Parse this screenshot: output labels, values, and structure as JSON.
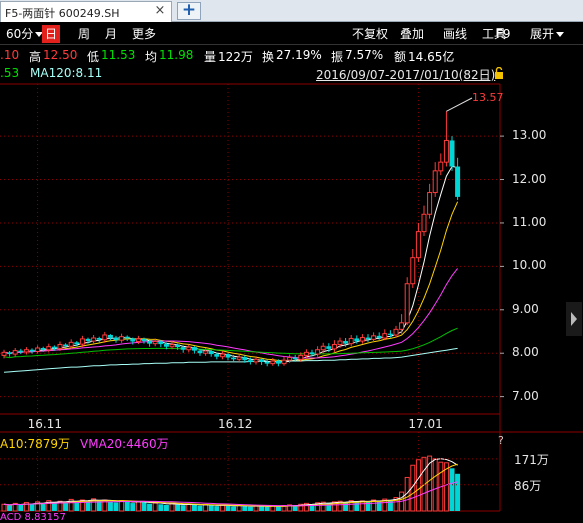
{
  "tab": {
    "title": "F5-两面针 600249.SH",
    "close_glyph": "×",
    "add_glyph": "+"
  },
  "toolbar": {
    "period": "60分",
    "active": "日",
    "week": "周",
    "month": "月",
    "more": "更多",
    "adjust": "不复权",
    "overlay": "叠加",
    "draw": "画线",
    "tools": "工具",
    "f9": "F9",
    "expand": "展开"
  },
  "quote": {
    "open_tail": ".10",
    "high_label": "高",
    "high": "12.50",
    "low_label": "低",
    "low": "11.53",
    "avg_label": "均",
    "avg": "11.98",
    "vol_label": "量",
    "vol": "122万",
    "turnover_label": "换",
    "turnover": "27.19%",
    "amp_label": "振",
    "amp": "7.57%",
    "amount_label": "额",
    "amount": "14.65亿"
  },
  "ma": {
    "tail": ".53",
    "ma120": "MA120:8.11"
  },
  "range_text": "2016/09/07-2017/01/10(82日)",
  "max_label": "13.57",
  "vol_header": {
    "vma10": "A10:7879万",
    "vma20": "VMA20:4460万",
    "help": "?"
  },
  "bottom_text": "ACD 8.83157",
  "colors": {
    "up": "#ff3b3b",
    "down": "#00d6d6",
    "ma_white": "#ffffff",
    "ma_yellow": "#ffd400",
    "ma_magenta": "#ff3cff",
    "ma_green": "#00c000",
    "ma_cyan": "#a8fff8",
    "grid": "#8b0000"
  },
  "chart_data": {
    "type": "candlestick",
    "title": "",
    "y_ticks": [
      "13.00",
      "12.00",
      "11.00",
      "10.00",
      "9.00",
      "8.00",
      "7.00"
    ],
    "ylim": [
      6.6,
      14.2
    ],
    "x_ticks": [
      "16.11",
      "16.12",
      "17.01"
    ],
    "volume_ticks": [
      "171万",
      "86万"
    ],
    "volume_max": 200,
    "series": [
      {
        "name": "K",
        "x": [
          1,
          2,
          3,
          4,
          5,
          6,
          7,
          8,
          9,
          10,
          11,
          12,
          13,
          14,
          15,
          16,
          17,
          18,
          19,
          20,
          21,
          22,
          23,
          24,
          25,
          26,
          27,
          28,
          29,
          30,
          31,
          32,
          33,
          34,
          35,
          36,
          37,
          38,
          39,
          40,
          41,
          42,
          43,
          44,
          45,
          46,
          47,
          48,
          49,
          50,
          51,
          52,
          53,
          54,
          55,
          56,
          57,
          58,
          59,
          60,
          61,
          62,
          63,
          64,
          65,
          66,
          67,
          68,
          69,
          70,
          71,
          72,
          73,
          74,
          75,
          76,
          77,
          78,
          79,
          80,
          81,
          82
        ],
        "open": [
          7.95,
          8.02,
          7.98,
          8.06,
          8.03,
          8.08,
          8.04,
          8.12,
          8.08,
          8.15,
          8.11,
          8.2,
          8.16,
          8.25,
          8.21,
          8.33,
          8.28,
          8.35,
          8.31,
          8.42,
          8.36,
          8.3,
          8.38,
          8.34,
          8.27,
          8.33,
          8.28,
          8.22,
          8.27,
          8.21,
          8.15,
          8.2,
          8.14,
          8.08,
          8.14,
          8.06,
          8.0,
          8.05,
          7.98,
          7.92,
          7.98,
          7.9,
          7.86,
          7.91,
          7.84,
          7.8,
          7.86,
          7.8,
          7.76,
          7.82,
          7.76,
          7.84,
          7.9,
          7.86,
          7.95,
          8.02,
          7.98,
          8.08,
          8.16,
          8.1,
          8.2,
          8.28,
          8.22,
          8.34,
          8.28,
          8.36,
          8.32,
          8.4,
          8.35,
          8.45,
          8.42,
          8.55,
          8.7,
          9.6,
          10.2,
          10.8,
          11.2,
          11.7,
          12.2,
          12.4,
          12.9,
          12.3
        ],
        "close": [
          8.02,
          7.98,
          8.06,
          8.03,
          8.08,
          8.04,
          8.12,
          8.08,
          8.15,
          8.11,
          8.2,
          8.16,
          8.25,
          8.21,
          8.33,
          8.28,
          8.35,
          8.31,
          8.42,
          8.36,
          8.3,
          8.38,
          8.34,
          8.27,
          8.33,
          8.28,
          8.22,
          8.27,
          8.21,
          8.15,
          8.2,
          8.14,
          8.08,
          8.14,
          8.06,
          8.0,
          8.05,
          7.98,
          7.92,
          7.98,
          7.9,
          7.86,
          7.91,
          7.84,
          7.8,
          7.86,
          7.8,
          7.76,
          7.82,
          7.76,
          7.84,
          7.9,
          7.86,
          7.95,
          8.02,
          7.98,
          8.08,
          8.16,
          8.1,
          8.2,
          8.28,
          8.22,
          8.34,
          8.28,
          8.36,
          8.32,
          8.4,
          8.35,
          8.45,
          8.42,
          8.55,
          8.7,
          9.6,
          10.2,
          10.8,
          11.2,
          11.7,
          12.2,
          12.4,
          12.9,
          12.3,
          11.6
        ],
        "high": [
          8.08,
          8.05,
          8.12,
          8.1,
          8.14,
          8.11,
          8.18,
          8.15,
          8.22,
          8.18,
          8.27,
          8.23,
          8.32,
          8.28,
          8.4,
          8.36,
          8.42,
          8.38,
          8.49,
          8.44,
          8.4,
          8.45,
          8.41,
          8.36,
          8.4,
          8.36,
          8.32,
          8.34,
          8.3,
          8.25,
          8.27,
          8.22,
          8.18,
          8.2,
          8.16,
          8.1,
          8.12,
          8.08,
          8.01,
          8.05,
          8.0,
          7.96,
          7.98,
          7.95,
          7.9,
          7.93,
          7.9,
          7.86,
          7.89,
          7.86,
          7.92,
          7.97,
          7.96,
          8.02,
          8.09,
          8.08,
          8.16,
          8.24,
          8.23,
          8.3,
          8.36,
          8.35,
          8.42,
          8.41,
          8.44,
          8.44,
          8.48,
          8.48,
          8.55,
          8.53,
          8.63,
          8.9,
          9.75,
          10.4,
          11.0,
          11.4,
          11.9,
          12.4,
          12.6,
          13.57,
          13.0,
          12.5
        ],
        "low": [
          7.88,
          7.92,
          7.92,
          7.98,
          7.97,
          7.99,
          7.99,
          8.03,
          8.02,
          8.06,
          8.05,
          8.11,
          8.1,
          8.16,
          8.14,
          8.22,
          8.21,
          8.25,
          8.24,
          8.3,
          8.24,
          8.24,
          8.28,
          8.2,
          8.21,
          8.22,
          8.15,
          8.16,
          8.14,
          8.09,
          8.09,
          8.08,
          8.01,
          8.02,
          7.99,
          7.94,
          7.94,
          7.92,
          7.86,
          7.86,
          7.84,
          7.8,
          7.8,
          7.78,
          7.74,
          7.74,
          7.73,
          7.7,
          7.71,
          7.7,
          7.71,
          7.78,
          7.8,
          7.8,
          7.89,
          7.92,
          7.92,
          7.99,
          8.03,
          8.03,
          8.12,
          8.15,
          8.16,
          8.22,
          8.22,
          8.26,
          8.26,
          8.31,
          8.3,
          8.36,
          8.36,
          8.45,
          8.65,
          9.5,
          10.1,
          10.7,
          11.1,
          11.6,
          12.1,
          12.3,
          12.2,
          11.53
        ]
      },
      {
        "name": "MA120",
        "values": [
          7.56,
          7.57,
          7.58,
          7.59,
          7.6,
          7.61,
          7.62,
          7.63,
          7.64,
          7.65,
          7.66,
          7.67,
          7.68,
          7.68,
          7.69,
          7.7,
          7.71,
          7.71,
          7.72,
          7.73,
          7.73,
          7.74,
          7.74,
          7.75,
          7.75,
          7.76,
          7.76,
          7.77,
          7.77,
          7.77,
          7.78,
          7.78,
          7.78,
          7.79,
          7.79,
          7.79,
          7.79,
          7.8,
          7.8,
          7.8,
          7.8,
          7.8,
          7.8,
          7.8,
          7.81,
          7.81,
          7.81,
          7.81,
          7.81,
          7.81,
          7.82,
          7.82,
          7.82,
          7.82,
          7.83,
          7.83,
          7.83,
          7.84,
          7.84,
          7.84,
          7.85,
          7.85,
          7.86,
          7.86,
          7.87,
          7.87,
          7.88,
          7.88,
          7.89,
          7.89,
          7.9,
          7.91,
          7.93,
          7.95,
          7.97,
          7.99,
          8.01,
          8.03,
          8.05,
          8.07,
          8.09,
          8.11
        ]
      }
    ],
    "volume": [
      22,
      18,
      25,
      20,
      28,
      24,
      30,
      26,
      34,
      28,
      32,
      30,
      38,
      32,
      36,
      34,
      40,
      33,
      36,
      30,
      28,
      34,
      30,
      26,
      31,
      28,
      24,
      26,
      22,
      20,
      24,
      21,
      19,
      23,
      20,
      17,
      21,
      18,
      16,
      20,
      17,
      15,
      18,
      16,
      14,
      17,
      15,
      14,
      17,
      15,
      18,
      20,
      19,
      22,
      25,
      23,
      27,
      29,
      26,
      30,
      32,
      29,
      34,
      31,
      33,
      30,
      36,
      34,
      39,
      37,
      44,
      62,
      110,
      150,
      168,
      176,
      180,
      171,
      160,
      158,
      140,
      122
    ]
  }
}
